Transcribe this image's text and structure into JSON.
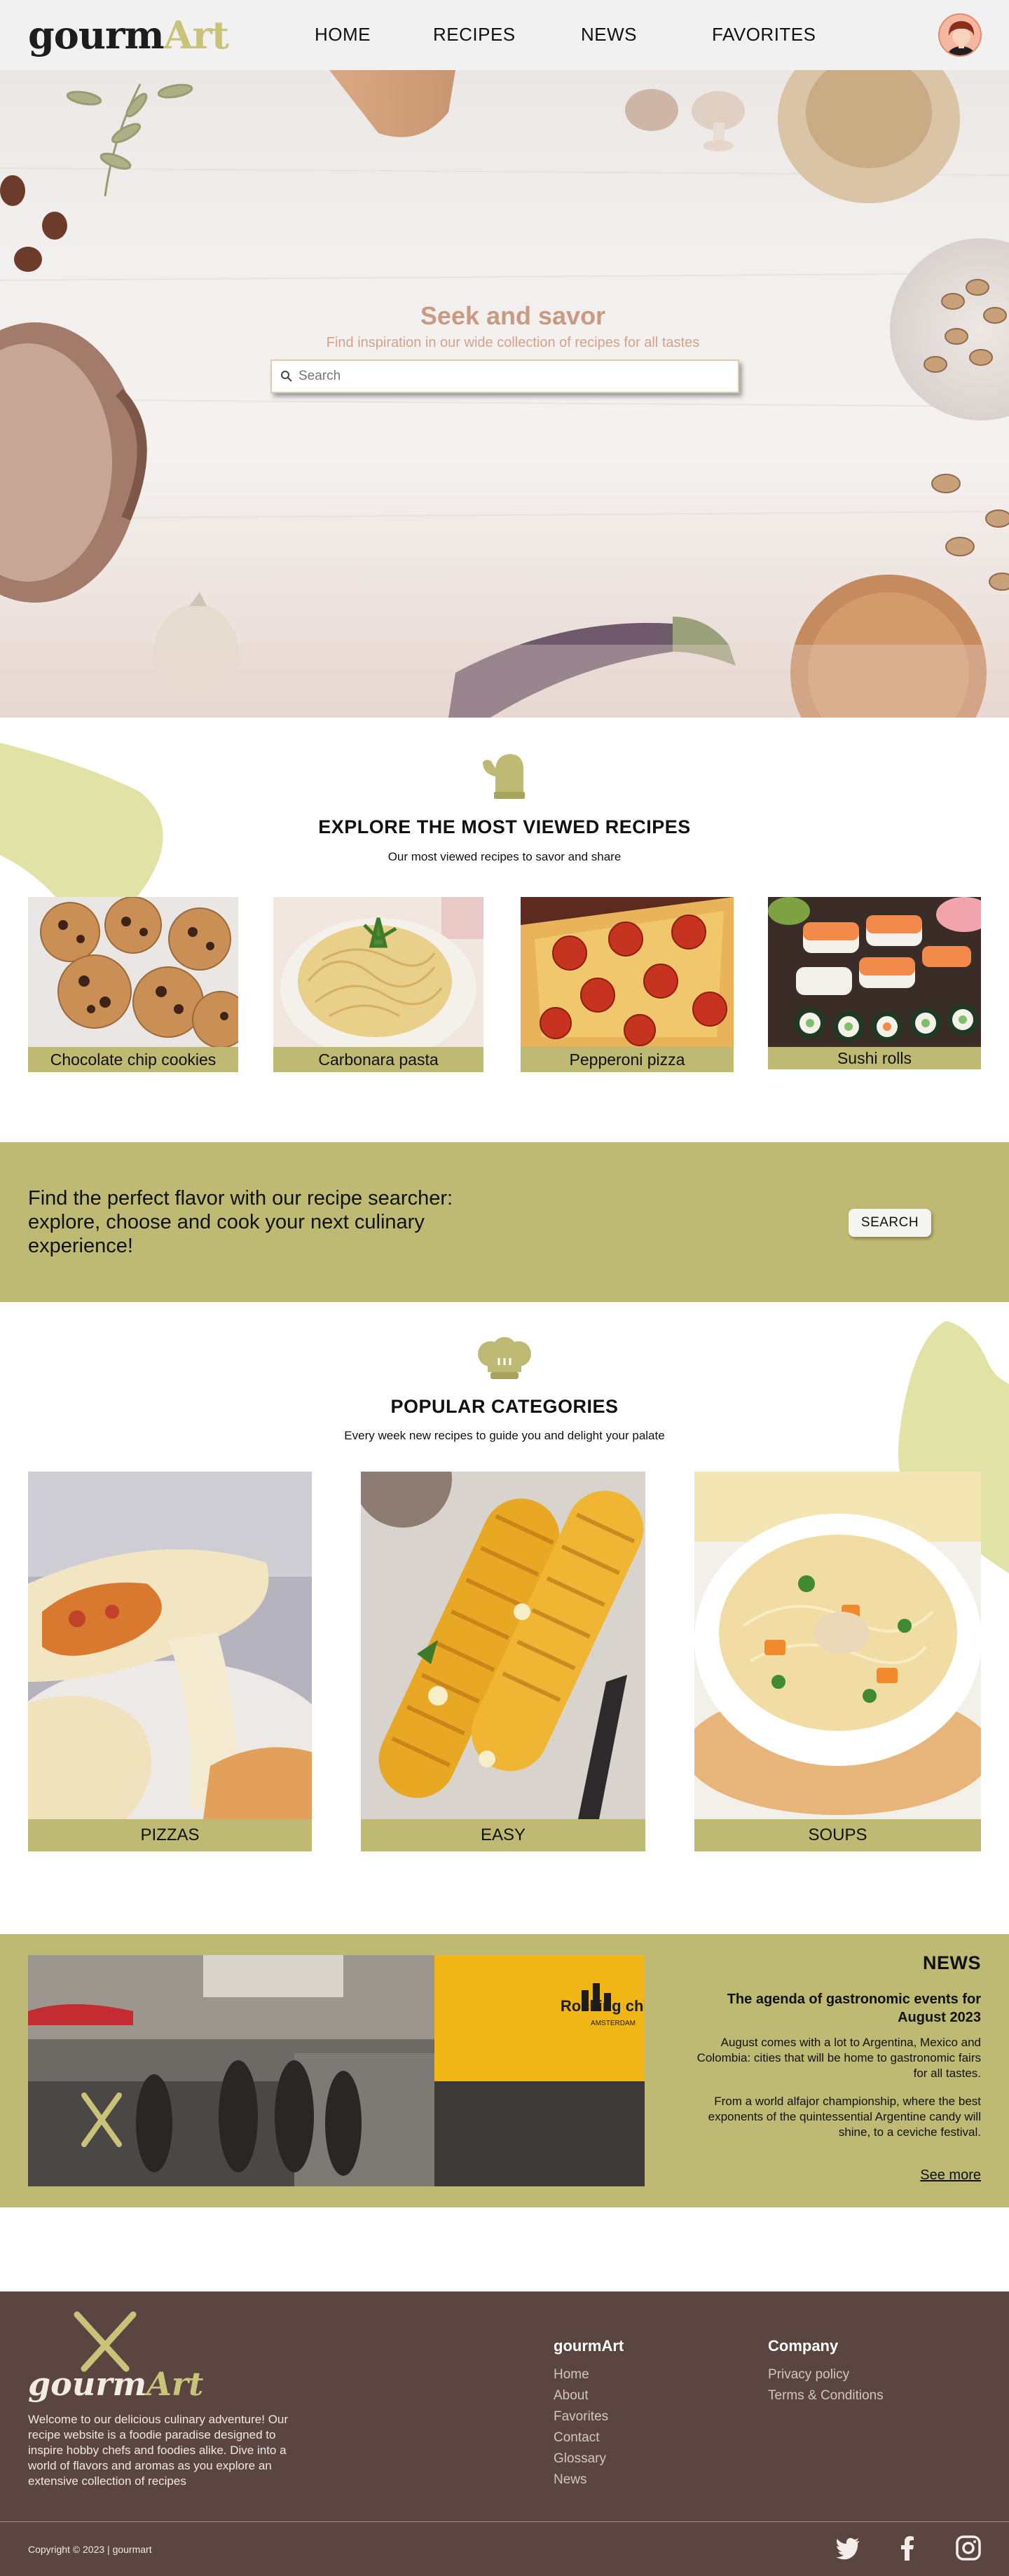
{
  "brand": {
    "part1": "gourm",
    "part2": "Art"
  },
  "nav": {
    "items": [
      "HOME",
      "RECIPES",
      "NEWS",
      "FAVORITES"
    ]
  },
  "hero": {
    "title": "Seek and savor",
    "subtitle": "Find inspiration in our wide collection of recipes for all tastes",
    "search_placeholder": "Search"
  },
  "explore": {
    "title": "EXPLORE THE MOST VIEWED RECIPES",
    "subtitle": "Our most viewed recipes to savor and share",
    "recipes": [
      "Chocolate chip cookies",
      "Carbonara pasta",
      "Pepperoni pizza",
      "Sushi rolls"
    ]
  },
  "searcher": {
    "text": "Find the perfect flavor with our recipe searcher: explore, choose and cook your next culinary experience!",
    "button": "SEARCH"
  },
  "categories": {
    "title": "POPULAR CATEGORIES",
    "subtitle": "Every week new recipes to guide you and delight your palate",
    "items": [
      "PIZZAS",
      "EASY",
      "SOUPS"
    ]
  },
  "news": {
    "heading": "NEWS",
    "title": "The agenda of gastronomic events for August 2023",
    "p1": "August comes with a lot to Argentina, Mexico and Colombia: cities that will be home to gastronomic fairs for all tastes.",
    "p2": "From a world alfajor championship, where the best exponents of the quintessential Argentine candy will shine, to a ceviche festival.",
    "more": "See more",
    "image_sign": "Rocking chips",
    "image_sign_sub": "AMSTERDAM"
  },
  "footer": {
    "about": "Welcome to our delicious culinary adventure! Our recipe website is a foodie paradise designed to inspire hobby chefs and foodies alike. Dive into a world of flavors and aromas as you explore an extensive collection of recipes",
    "col1_title": "gourmArt",
    "col1_links": [
      "Home",
      "About",
      "Favorites",
      "Contact",
      "Glossary",
      "News"
    ],
    "col2_title": "Company",
    "col2_links": [
      "Privacy policy",
      "Terms & Conditions"
    ],
    "copyright": "Copyright © 2023  |   gourmart",
    "social": [
      "twitter-icon",
      "facebook-icon",
      "instagram-icon"
    ]
  },
  "colors": {
    "accent": "#bfba73",
    "blob": "#e1e3a6",
    "footer": "#5a4540",
    "hero_title": "#c89a82"
  }
}
